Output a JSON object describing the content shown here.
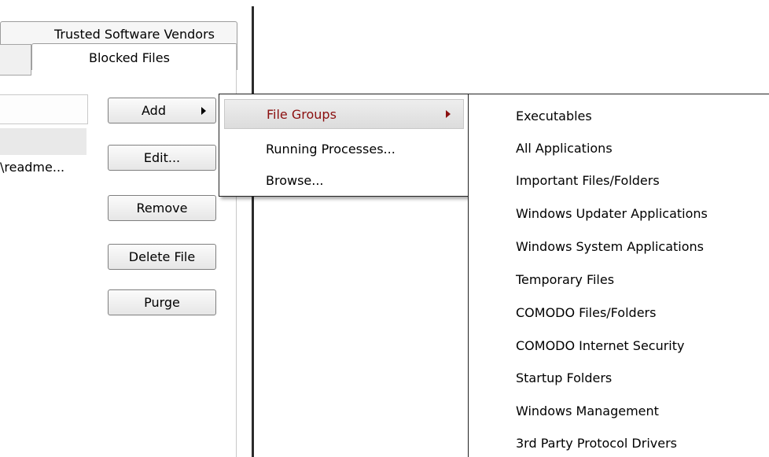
{
  "tabs": {
    "trusted_vendors": "Trusted Software Vendors",
    "blocked_files": "Blocked Files"
  },
  "list": {
    "row_path": "\\readme..."
  },
  "buttons": {
    "add": "Add",
    "edit": "Edit...",
    "remove": "Remove",
    "delete_file": "Delete File",
    "purge": "Purge"
  },
  "add_menu": {
    "file_groups": "File Groups",
    "running_processes": "Running Processes...",
    "browse": "Browse..."
  },
  "file_groups_menu": [
    "Executables",
    "All Applications",
    "Important Files/Folders",
    "Windows Updater Applications",
    "Windows System Applications",
    "Temporary Files",
    "COMODO Files/Folders",
    "COMODO Internet Security",
    "Startup Folders",
    "Windows Management",
    "3rd Party Protocol Drivers"
  ],
  "colors": {
    "highlight_text": "#8b0f0f",
    "menu_border": "#222222"
  }
}
